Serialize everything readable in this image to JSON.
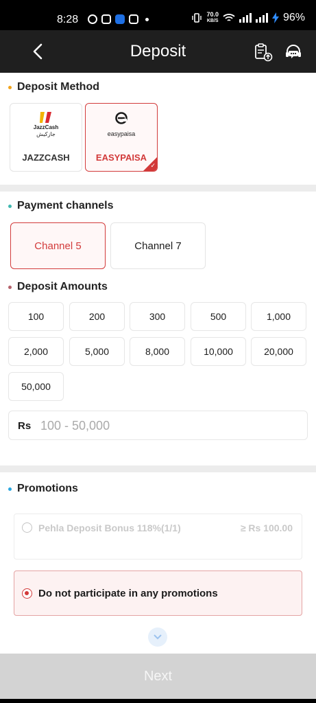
{
  "status_bar": {
    "time": "8:28",
    "net_speed_value": "70.0",
    "net_speed_unit": "KB/S",
    "battery": "96%"
  },
  "header": {
    "title": "Deposit",
    "back_icon": "chevron-left-icon",
    "history_icon": "clipboard-upload-icon",
    "support_icon": "headset-chat-icon"
  },
  "deposit_method": {
    "title": "Deposit Method",
    "dot_color": "#f2a31b",
    "methods": [
      {
        "label": "JAZZCASH",
        "logo_text": "JazzCash",
        "logo_subtext": "جازکیش",
        "selected": false
      },
      {
        "label": "EASYPAISA",
        "logo_text": "easypaisa",
        "selected": true
      }
    ]
  },
  "payment_channels": {
    "title": "Payment channels",
    "dot_color": "#3fb8b0",
    "channels": [
      {
        "label": "Channel 5",
        "selected": true
      },
      {
        "label": "Channel 7",
        "selected": false
      }
    ]
  },
  "deposit_amounts": {
    "title": "Deposit Amounts",
    "dot_color": "#b5616b",
    "amounts": [
      "100",
      "200",
      "300",
      "500",
      "1,000",
      "2,000",
      "5,000",
      "8,000",
      "10,000",
      "20,000",
      "50,000"
    ],
    "currency": "Rs",
    "placeholder": "100 - 50,000"
  },
  "promotions": {
    "title": "Promotions",
    "dot_color": "#2aa7e0",
    "options": [
      {
        "label": "Pehla Deposit Bonus 118%(1/1)",
        "min": "≥ Rs 100.00",
        "selected": false,
        "disabled": true
      },
      {
        "label": "Do not participate in any promotions",
        "selected": true
      }
    ]
  },
  "next_label": "Next",
  "colors": {
    "accent": "#d23a3a",
    "header_bg": "#1f1f1f"
  }
}
